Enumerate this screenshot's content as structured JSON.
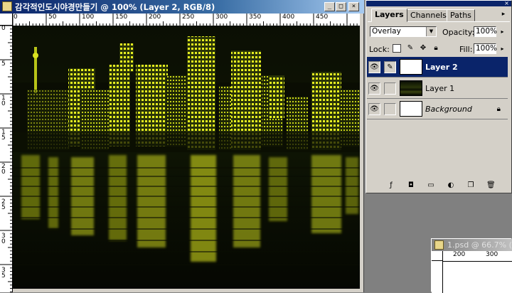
{
  "document": {
    "title": "감각적인도시야경만들기 @ 100% (Layer 2, RGB/8)",
    "ruler_h": [
      "0",
      "50",
      "100",
      "150",
      "200",
      "250",
      "300",
      "350",
      "400",
      "450"
    ],
    "ruler_v": [
      "0",
      "5",
      "1 0",
      "1 5",
      "2 0",
      "2 5",
      "3 0",
      "3 5"
    ]
  },
  "window_buttons": {
    "minimize": "_",
    "maximize": "□",
    "close": "×"
  },
  "palette": {
    "tabs": [
      "Layers",
      "Channels",
      "Paths"
    ],
    "blend_mode": "Overlay",
    "opacity_label": "Opacity:",
    "opacity_value": "100%",
    "lock_label": "Lock:",
    "fill_label": "Fill:",
    "fill_value": "100%",
    "layers": [
      {
        "name": "Layer 2",
        "selected": true
      },
      {
        "name": "Layer 1",
        "selected": false
      },
      {
        "name": "Background",
        "selected": false,
        "locked": true
      }
    ]
  },
  "doc2": {
    "title": "1.psd @ 66.7% (",
    "ruler_h": [
      "200",
      "300"
    ]
  }
}
